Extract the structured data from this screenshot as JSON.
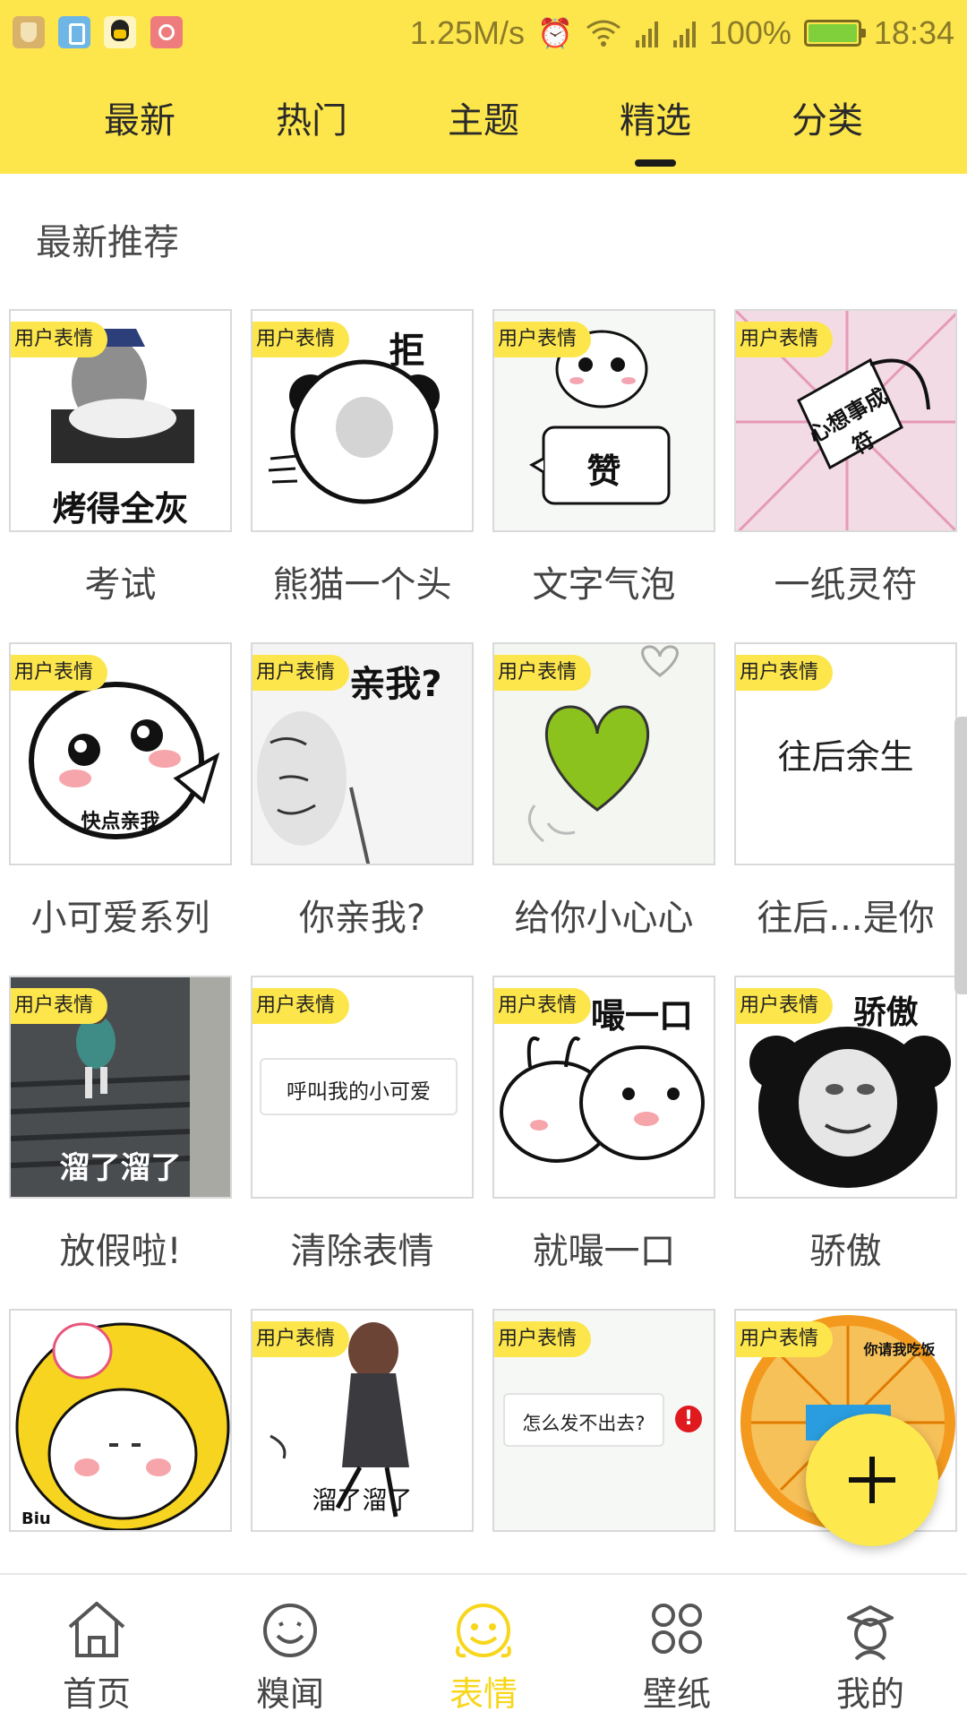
{
  "status_bar": {
    "speed": "1.25M/s",
    "battery": "100%",
    "time": "18:34",
    "left_icons": [
      "shield-icon",
      "usb-icon",
      "qq-icon",
      "camera-icon"
    ],
    "right_icons": [
      "alarm-icon",
      "wifi-icon",
      "signal-icon",
      "signal-icon",
      "battery-icon"
    ]
  },
  "top_tabs": [
    {
      "label": "最新"
    },
    {
      "label": "热门"
    },
    {
      "label": "主题"
    },
    {
      "label": "精选",
      "active": true
    },
    {
      "label": "分类"
    }
  ],
  "section": {
    "title": "最新推荐"
  },
  "badge_text": "用户表情",
  "items": [
    {
      "label": "考试",
      "badge": true,
      "caption": "烤得全灰"
    },
    {
      "label": "熊猫一个头",
      "badge": true,
      "caption": "拒"
    },
    {
      "label": "文字气泡",
      "badge": true,
      "caption": "赞"
    },
    {
      "label": "一纸灵符",
      "badge": true,
      "caption": "心想事成符"
    },
    {
      "label": "小可爱系列",
      "badge": true,
      "caption": "快点亲我"
    },
    {
      "label": "你亲我?",
      "badge": true,
      "caption": "亲我?"
    },
    {
      "label": "给你小心心",
      "badge": true,
      "caption": ""
    },
    {
      "label": "往后...是你",
      "badge": true,
      "caption": "往后余生"
    },
    {
      "label": "放假啦!",
      "badge": true,
      "caption": "溜了溜了"
    },
    {
      "label": "清除表情",
      "badge": true,
      "caption": "呼叫我的小可爱"
    },
    {
      "label": "就嘬一口",
      "badge": true,
      "caption": "嘬一口"
    },
    {
      "label": "骄傲",
      "badge": true,
      "caption": "骄傲"
    },
    {
      "label": "",
      "badge": false,
      "caption": "Biu"
    },
    {
      "label": "",
      "badge": true,
      "caption": "溜了溜了"
    },
    {
      "label": "",
      "badge": true,
      "caption": "怎么发不出去?"
    },
    {
      "label": "",
      "badge": true,
      "caption": "你请我吃饭"
    }
  ],
  "bottom_nav": [
    {
      "label": "首页",
      "icon": "home-icon"
    },
    {
      "label": "糗闻",
      "icon": "smiley-icon"
    },
    {
      "label": "表情",
      "icon": "emoji-face-icon",
      "active": true
    },
    {
      "label": "壁纸",
      "icon": "clover-grid-icon"
    },
    {
      "label": "我的",
      "icon": "profile-icon"
    }
  ],
  "fab": {
    "icon": "plus-icon"
  },
  "colors": {
    "accent": "#fde64b",
    "active_nav": "#f7d61b",
    "text": "#444444"
  }
}
